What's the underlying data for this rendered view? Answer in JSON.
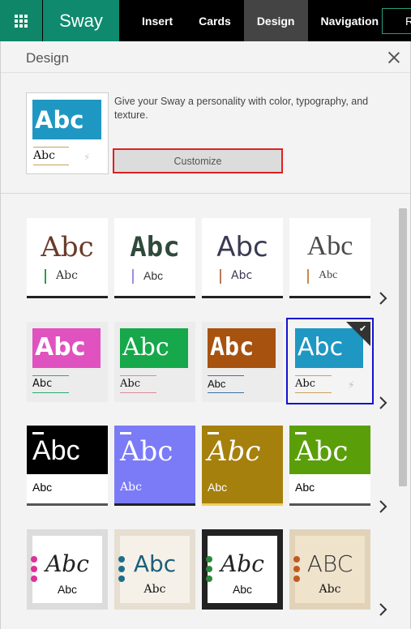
{
  "app": {
    "name": "Sway"
  },
  "topbar": {
    "tabs": [
      {
        "label": "Insert"
      },
      {
        "label": "Cards"
      },
      {
        "label": "Design"
      },
      {
        "label": "Navigation"
      }
    ],
    "share_label": "R"
  },
  "pane": {
    "title": "Design",
    "description": "Give your Sway a personality with color, typography, and texture.",
    "customize_label": "Customize",
    "preview": {
      "big": "Abc",
      "small": "Abc"
    }
  },
  "gallery": {
    "row1": [
      {
        "big": "Abc",
        "small": "Abc",
        "accent": "#2e9e45"
      },
      {
        "big": "Abc",
        "small": "Abc",
        "accent": "#9b8fe6"
      },
      {
        "big": "Abc",
        "small": "Abc",
        "accent": "#b97a59"
      },
      {
        "big": "Abc",
        "small": "Abc",
        "accent": "#c8894a"
      }
    ],
    "row2": [
      {
        "big": "Abc",
        "small": "Abc",
        "banner": "#e052c0"
      },
      {
        "big": "Abc",
        "small": "Abc",
        "banner": "#16a84a"
      },
      {
        "big": "Abc",
        "small": "Abc",
        "banner": "#a85210"
      },
      {
        "big": "Abc",
        "small": "Abc",
        "banner": "#1f97c3",
        "selected": true
      }
    ],
    "row3": [
      {
        "big": "Abc",
        "small": "Abc",
        "color": "#000000"
      },
      {
        "big": "Abc",
        "small": "Abc",
        "color": "#7b7bf7"
      },
      {
        "big": "Abc",
        "small": "Abc",
        "color": "#a6800d"
      },
      {
        "big": "Abc",
        "small": "Abc",
        "color": "#5a9f0a"
      }
    ],
    "row4": [
      {
        "big": "Abc",
        "small": "Abc",
        "dot": "#e0309a"
      },
      {
        "big": "Abc",
        "small": "Abc",
        "dot": "#1d6f8c"
      },
      {
        "big": "Abc",
        "small": "Abc",
        "dot": "#2a8a3a"
      },
      {
        "big": "ABC",
        "small": "Abc",
        "dot": "#c05a1c"
      }
    ]
  }
}
